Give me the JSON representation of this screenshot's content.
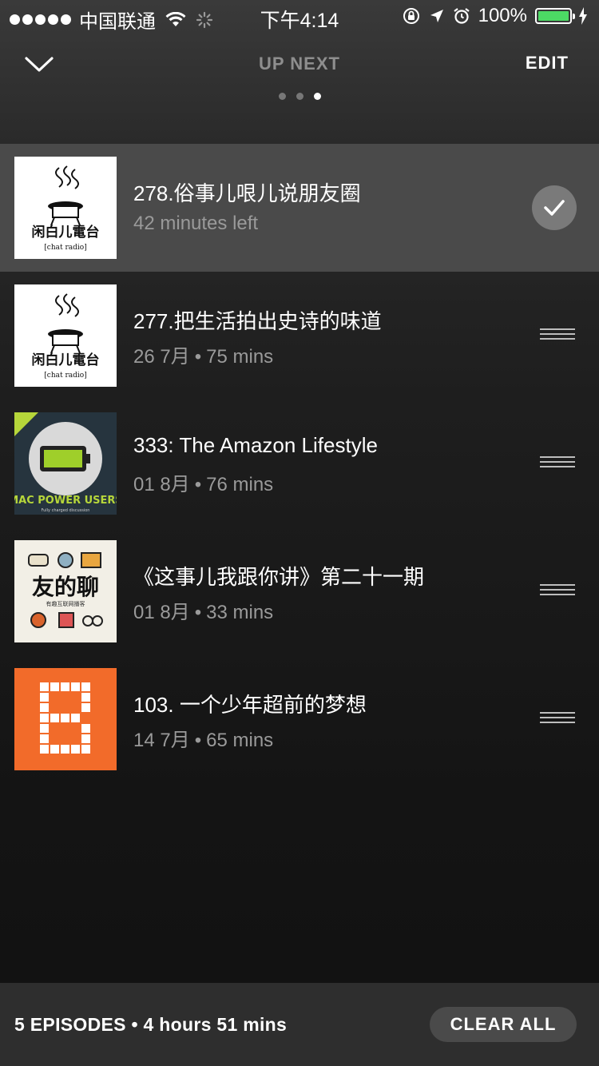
{
  "status_bar": {
    "carrier": "中国联通",
    "time": "下午4:14",
    "battery_percent": "100%",
    "battery_level": 1.0,
    "icons": [
      "signal-dots-icon",
      "wifi-icon",
      "activity-spinner-icon",
      "orientation-lock-icon",
      "location-arrow-icon",
      "alarm-icon",
      "battery-icon",
      "charging-bolt-icon"
    ]
  },
  "header": {
    "title": "UP NEXT",
    "edit_label": "EDIT",
    "page_count": 3,
    "active_page": 3
  },
  "episodes": [
    {
      "title": "278.俗事儿哏儿说朋友圈",
      "meta": "42 minutes left",
      "artwork": "chat-radio",
      "artwork_text": [
        "闲白儿電台",
        "[chat radio]"
      ],
      "current": true
    },
    {
      "title": "277.把生活拍出史诗的味道",
      "date": "26 7月",
      "duration": "75 mins",
      "artwork": "chat-radio",
      "artwork_text": [
        "闲白儿電台",
        "[chat radio]"
      ]
    },
    {
      "title": "333: The Amazon Lifestyle",
      "date": "01 8月",
      "duration": "76 mins",
      "artwork": "mac-power-users",
      "artwork_text": [
        "MAC POWER USERS",
        "Fully charged discussion"
      ]
    },
    {
      "title": "《这事儿我跟你讲》第二十一期",
      "date": "01 8月",
      "duration": "33 mins",
      "artwork": "you-de-liao",
      "artwork_text": [
        "友的聊",
        "有趣互联网播客"
      ]
    },
    {
      "title": "103. 一个少年超前的梦想",
      "date": "14 7月",
      "duration": "65 mins",
      "artwork": "b-pixel",
      "artwork_text": []
    }
  ],
  "footer": {
    "summary": "5 EPISODES • 4 hours 51 mins",
    "clear_label": "CLEAR ALL"
  },
  "colors": {
    "current_row": "#4a4a4a",
    "battery_green": "#4cd964",
    "b_art_orange": "#f26b2a"
  }
}
